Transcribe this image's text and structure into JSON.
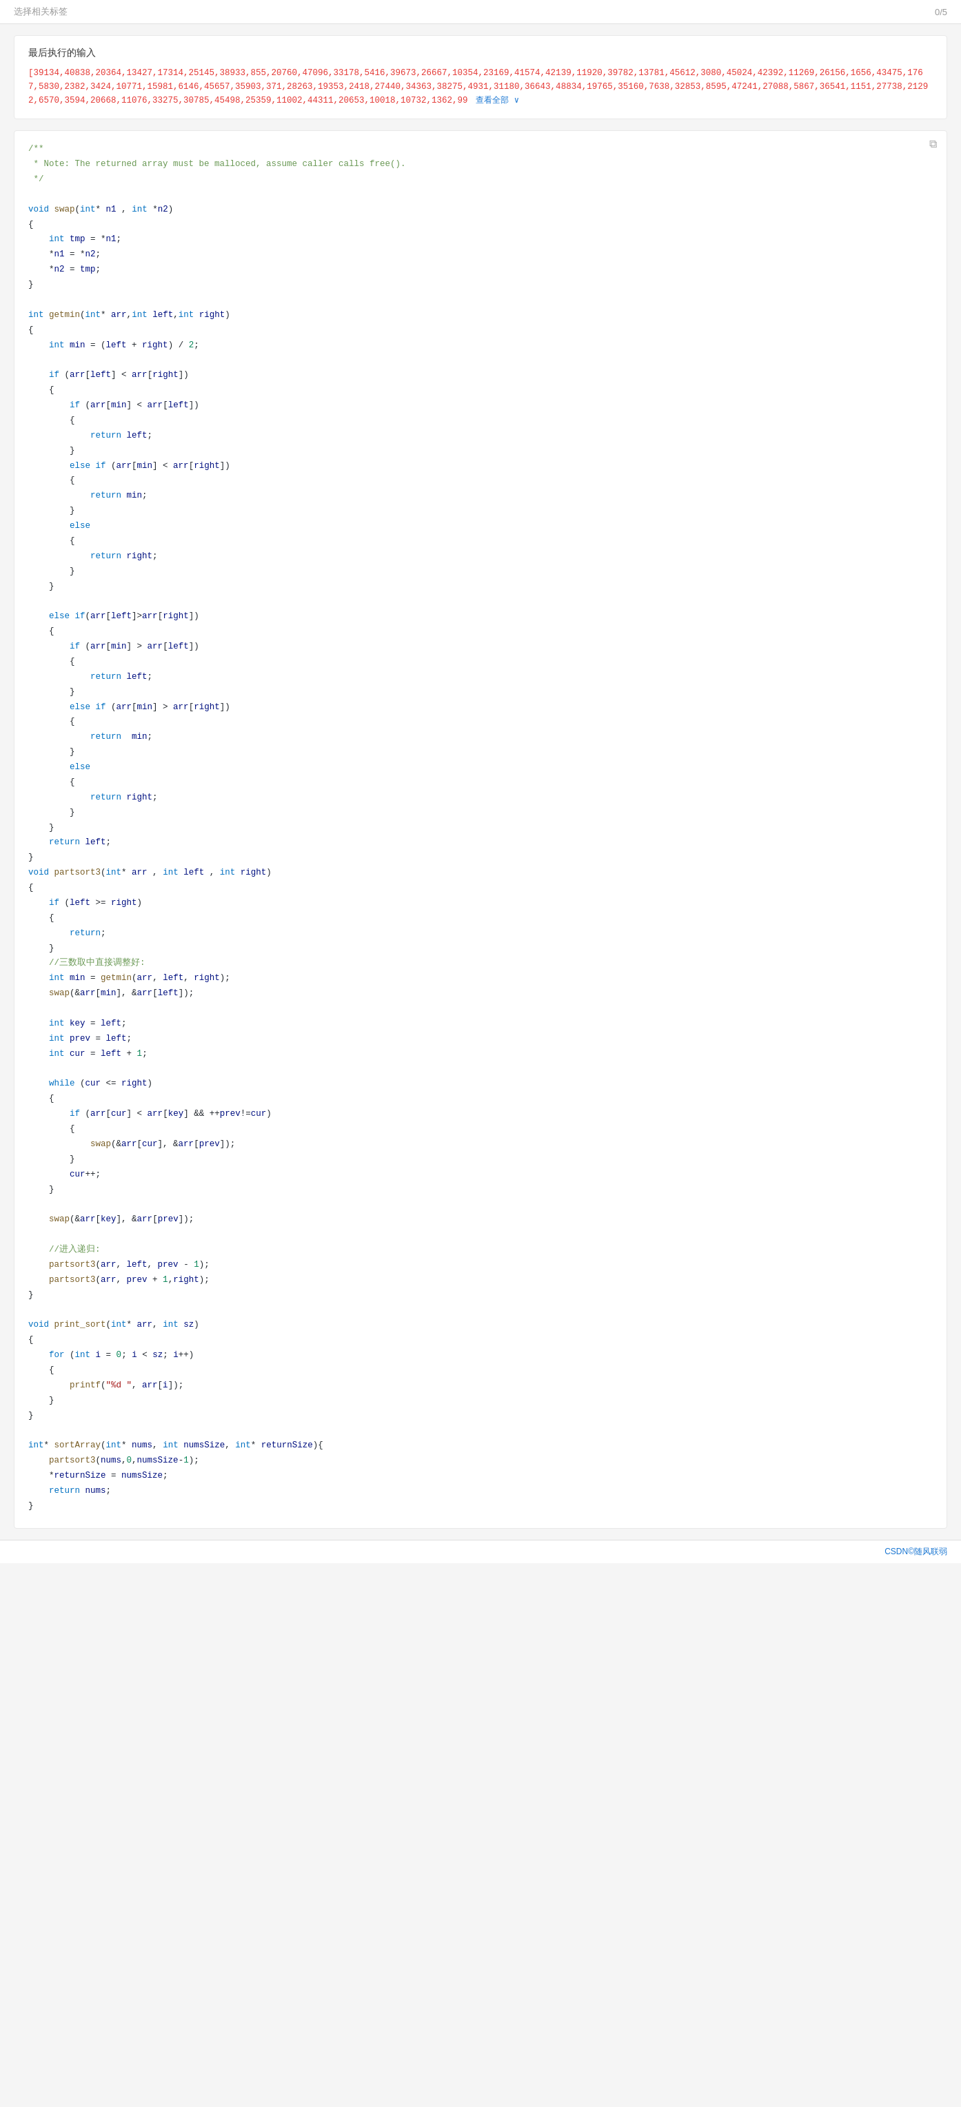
{
  "topbar": {
    "label": "选择相关标签",
    "count": "0/5"
  },
  "lastInput": {
    "title": "最后执行的输入",
    "data": "[39134,40838,20364,13427,17314,25145,38933,855,20760,47096,33178,5416,39673,26667,10354,23169,41574,42139,11920,39782,13781,45612,3080,45024,42392,11269,26156,1656,43475,1767,5830,2382,3424,10771,15981,6146,45657,35903,371,28263,19353,2418,27440,34363,38275,4931,31180,36643,48834,19765,35160,7638,32853,8595,47241,27088,5867,36541,1151,27738,21292,6570,3594,20668,11076,33275,30785,45498,25359,11002,44311,20653,10018,10732,1362,99",
    "viewAll": "查看全部",
    "expandIcon": "∨"
  },
  "code": {
    "copyTitle": "复制",
    "content": "code_block"
  },
  "footer": {
    "text": "CSDN©随风联弱"
  }
}
